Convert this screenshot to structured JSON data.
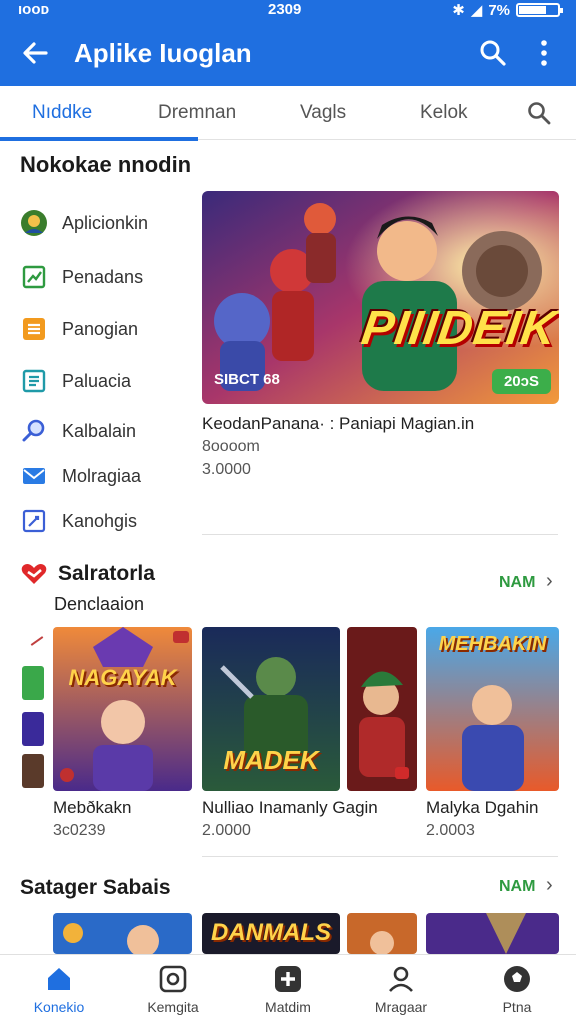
{
  "status": {
    "left": "ıooᴅ",
    "time": "2309",
    "battery_text": "7%",
    "battery_level": 0.7
  },
  "app_bar": {
    "title": "Aplike Iuoglan"
  },
  "tabs": [
    {
      "label": "Nıddke",
      "active": true
    },
    {
      "label": "Dremnan",
      "active": false
    },
    {
      "label": "Vagls",
      "active": false
    },
    {
      "label": "Kelok",
      "active": false
    }
  ],
  "sidebar": {
    "heading": "Nokokae nnodin",
    "items": [
      {
        "label": "Aplicionkin",
        "icon": "avatar-icon"
      },
      {
        "label": "Penadans",
        "icon": "chart-icon"
      },
      {
        "label": "Panogian",
        "icon": "list-icon"
      },
      {
        "label": "Paluacia",
        "icon": "document-icon"
      },
      {
        "label": "Kalbalain",
        "icon": "search-icon"
      },
      {
        "label": "Molragiaa",
        "icon": "mail-icon"
      },
      {
        "label": "Kanohgis",
        "icon": "edit-icon"
      }
    ]
  },
  "featured": {
    "logo": "PIIIDEIK",
    "tag": "SIBCT 68",
    "badge": "20ɔS",
    "title": "KeodanPanana· : Paniapi Magian.in",
    "sub1": "8oooom",
    "sub2": "3.0000"
  },
  "section1": {
    "title": "Salratorla",
    "subtitle": "Denclaaion",
    "more": "NAM",
    "items": [
      {
        "name": "Mebðkakn",
        "size": "3c0239",
        "logo": "NAGAYAK"
      },
      {
        "name": "Nulliao Inamanly Gagin",
        "size": "2.0000",
        "logo": "MADEK"
      },
      {
        "name": "Malyka Dgahin",
        "size": "2.0003",
        "logo": "MEHBAKIN"
      }
    ]
  },
  "section2": {
    "title": "Satager Sabais",
    "more": "NAM",
    "logo": "DANMALS"
  },
  "bottom_nav": [
    {
      "label": "Konekio",
      "icon": "home-icon",
      "active": true
    },
    {
      "label": "Kemgita",
      "icon": "camera-icon",
      "active": false
    },
    {
      "label": "Matdim",
      "icon": "plus-icon",
      "active": false
    },
    {
      "label": "Mragaar",
      "icon": "person-icon",
      "active": false
    },
    {
      "label": "Ptna",
      "icon": "soccer-icon",
      "active": false
    }
  ],
  "colors": {
    "primary": "#1f6fe0",
    "accent_green": "#2e9a40",
    "badge_green": "#3cae4a"
  }
}
